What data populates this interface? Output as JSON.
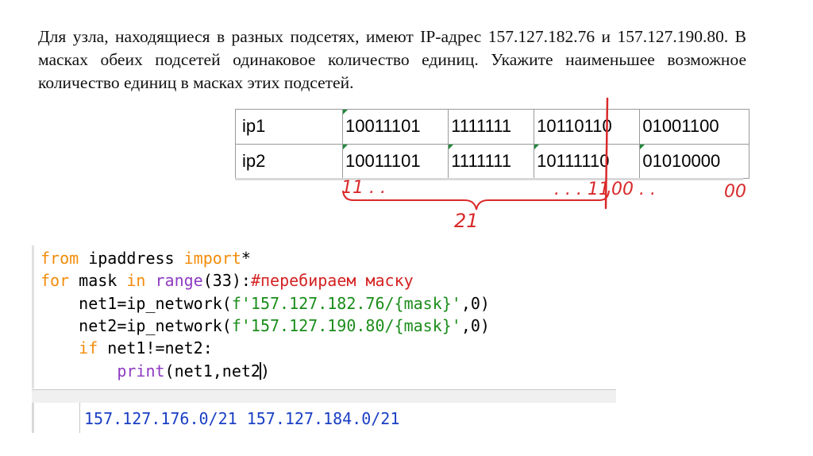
{
  "task": {
    "text": "Для узла, находящиеся в разных подсетях, имеют IP-адрес 157.127.182.76 и 157.127.190.80. В масках обеих подсетей одинаковое количество единиц. Укажите наименьшее возможное количество единиц в масках этих подсетей."
  },
  "table": {
    "rows": [
      {
        "label": "ip1",
        "octets": [
          "10011101",
          "1111111",
          "10110110",
          "01001100"
        ]
      },
      {
        "label": "ip2",
        "octets": [
          "10011101",
          "1111111",
          "10111110",
          "01010000"
        ]
      }
    ]
  },
  "annotations": {
    "left_ones": "11 . .",
    "mid_ones": ". . . 11",
    "zeros_after_line": "00 .  .",
    "zeros_end": "00",
    "count": "21",
    "color": "#d9292a"
  },
  "code": {
    "line1": {
      "kw1": "from",
      "mod": " ipaddress ",
      "kw2": "import",
      "rest": "*"
    },
    "line2": {
      "kw1": "for",
      "var": " mask ",
      "kw2": "in",
      "sp": " ",
      "fn": "range",
      "args": "(33):",
      "comment": "#перебираем маску"
    },
    "line3": {
      "indent": "    ",
      "lhs": "net1=ip_network(",
      "str": "f'157.127.182.76/{mask}'",
      "rest": ",0)"
    },
    "line4": {
      "indent": "    ",
      "lhs": "net2=ip_network(",
      "str": "f'157.127.190.80/{mask}'",
      "rest": ",0)"
    },
    "line5": {
      "indent": "    ",
      "kw": "if",
      "rest": " net1!=net2:"
    },
    "line6": {
      "indent": "        ",
      "fn": "print",
      "args": "(net1,net2",
      "close": ")"
    }
  },
  "shell": {
    "output": "157.127.176.0/21 157.127.184.0/21"
  }
}
